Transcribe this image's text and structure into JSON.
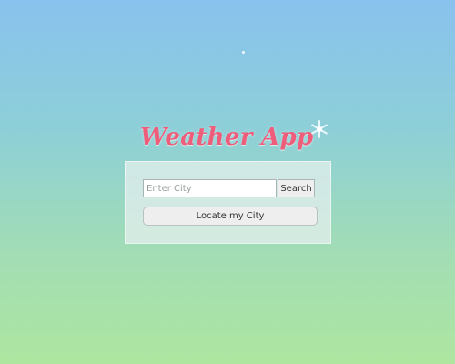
{
  "app": {
    "title": "Weather App",
    "title_color": "#ee5d7a",
    "title_icon": "snowflake-icon"
  },
  "search": {
    "placeholder": "Enter City",
    "value": "",
    "button_label": "Search"
  },
  "locate": {
    "button_label": "Locate my City"
  },
  "theme": {
    "background_top": "#89c2ee",
    "background_bottom": "#aee6a0",
    "panel_background": "#e8f0f0"
  }
}
